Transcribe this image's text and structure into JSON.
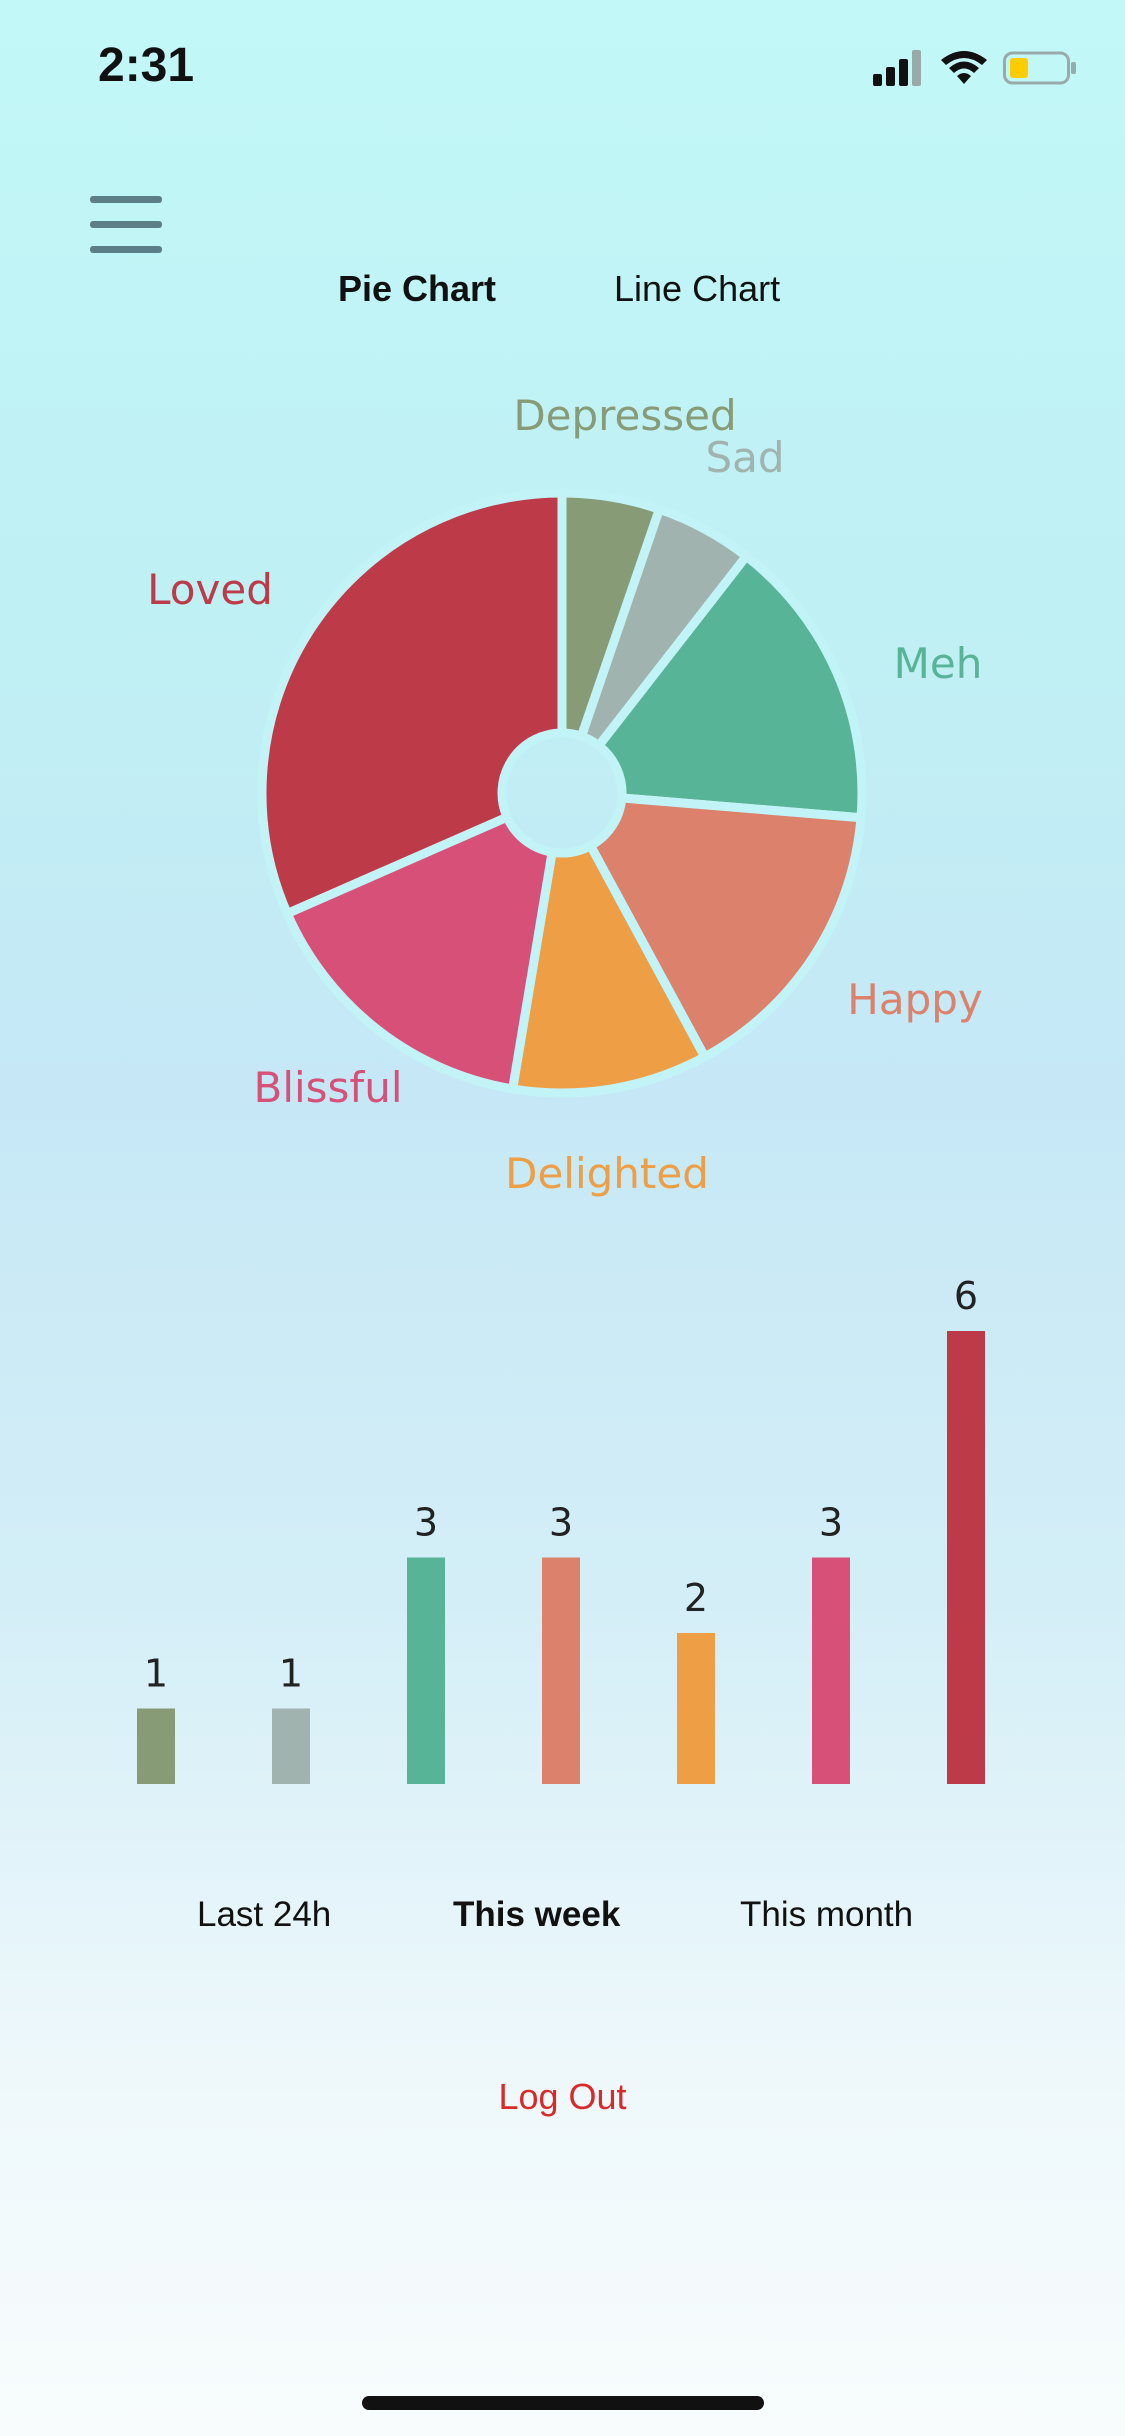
{
  "status_bar": {
    "time": "2:31"
  },
  "tabs": [
    {
      "label": "Pie Chart",
      "active": true
    },
    {
      "label": "Line Chart",
      "active": false
    }
  ],
  "chart_data": [
    {
      "type": "pie",
      "categories": [
        "Depressed",
        "Sad",
        "Meh",
        "Happy",
        "Delighted",
        "Blissful",
        "Loved"
      ],
      "values": [
        1,
        1,
        3,
        3,
        2,
        3,
        6
      ],
      "colors": [
        "#879b76",
        "#a0b3ae",
        "#58b497",
        "#dc816c",
        "#ee9e45",
        "#d65078",
        "#bd3a48"
      ]
    },
    {
      "type": "bar",
      "categories": [
        "Depressed",
        "Sad",
        "Meh",
        "Happy",
        "Delighted",
        "Blissful",
        "Loved"
      ],
      "values": [
        1,
        1,
        3,
        3,
        2,
        3,
        6
      ],
      "value_labels": [
        "1",
        "1",
        "3",
        "3",
        "2",
        "3",
        "6"
      ],
      "colors": [
        "#879b76",
        "#a0b3ae",
        "#58b497",
        "#dc816c",
        "#ee9e45",
        "#d65078",
        "#bd3a48"
      ],
      "ylim": [
        0,
        6
      ]
    }
  ],
  "periods": [
    {
      "label": "Last 24h",
      "active": false
    },
    {
      "label": "This week",
      "active": true
    },
    {
      "label": "This month",
      "active": false
    }
  ],
  "logout_label": "Log Out",
  "colors": {
    "accent": "#d92a2a",
    "menu_icon": "#5c7f87"
  }
}
